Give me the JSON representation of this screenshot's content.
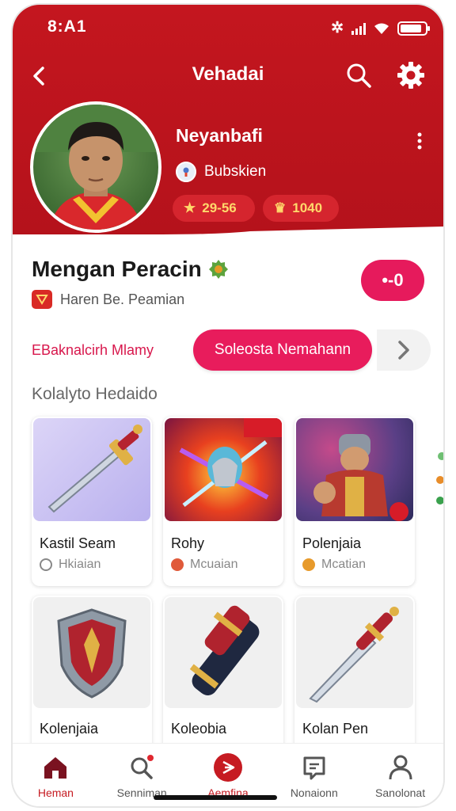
{
  "status_bar": {
    "time": "8:A1",
    "bluetooth": "bluetooth-icon"
  },
  "navbar": {
    "title": "Vehadai"
  },
  "profile": {
    "name": "Neyanbafi",
    "role": "Bubskien",
    "stat_1": "29-56",
    "stat_2": "1040"
  },
  "section": {
    "title": "Mengan Peracin",
    "subtitle": "Haren Be. Peamian",
    "pill_label": "•-0"
  },
  "actions": {
    "link_text": "EBaknalcirh Mlamy",
    "cta_label": "Soleosta Nemahann"
  },
  "list": {
    "title": "Kolalyto Hedaido",
    "items": [
      {
        "name": "Kastil Seam",
        "meta": "Hkiaian"
      },
      {
        "name": "Rohy",
        "meta": "Mcuaian"
      },
      {
        "name": "Polenjaia",
        "meta": "Mcatian"
      },
      {
        "name": "Kolenjaia"
      },
      {
        "name": "Koleobia"
      },
      {
        "name": "Kolan Pen"
      }
    ]
  },
  "bottom_nav": [
    {
      "label": "Heman",
      "icon": "home-icon"
    },
    {
      "label": "Senniman",
      "icon": "search-icon"
    },
    {
      "label": "Aemfina",
      "icon": "play-icon"
    },
    {
      "label": "Nonaionn",
      "icon": "chat-icon"
    },
    {
      "label": "Sanolonat",
      "icon": "profile-icon"
    }
  ],
  "colors": {
    "primary": "#c4161f",
    "accent": "#e81c5c",
    "stat_text": "#ffd86b"
  }
}
